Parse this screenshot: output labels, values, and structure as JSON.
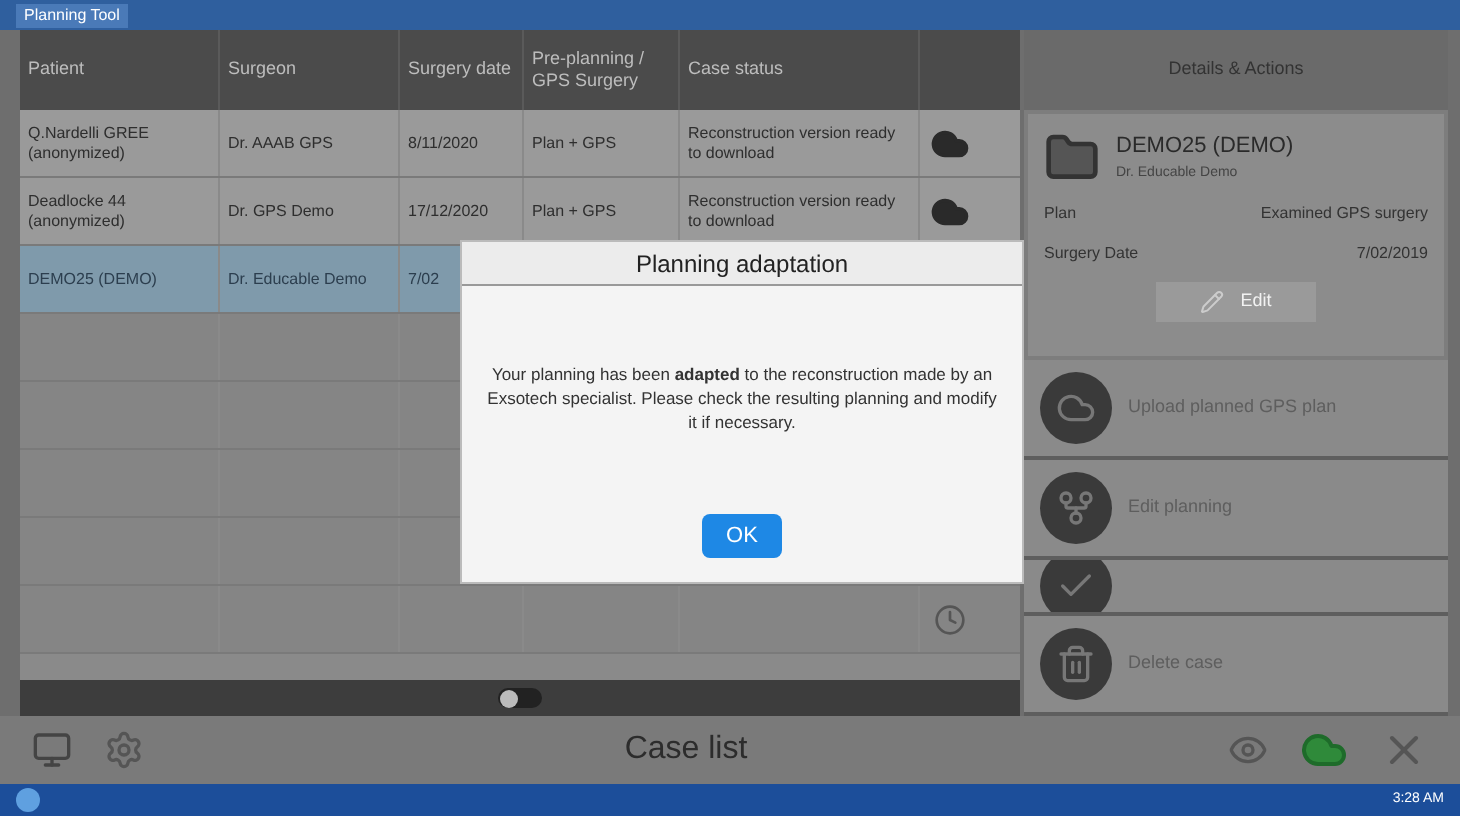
{
  "window": {
    "title": "Planning Tool"
  },
  "table": {
    "columns": [
      "Patient",
      "Surgeon",
      "Surgery date",
      "Pre-planning / GPS Surgery",
      "Case status"
    ],
    "rows": [
      {
        "cells": [
          "Q.Nardelli GREE (anonymized)",
          "Dr. AAAB GPS",
          "8/11/2020",
          "Plan + GPS",
          "Reconstruction version ready to download"
        ],
        "kind": "download",
        "selected": false
      },
      {
        "cells": [
          "Deadlocke 44 (anonymized)",
          "Dr. GPS Demo",
          "17/12/2020",
          "Plan + GPS",
          "Reconstruction version ready to download"
        ],
        "kind": "download",
        "selected": false
      },
      {
        "cells": [
          "DEMO25 (DEMO)",
          "Dr. Educable Demo",
          "7/02"
        ],
        "kind": "plain",
        "selected": true
      },
      {
        "cells": [],
        "kind": "plain",
        "selected": false
      },
      {
        "cells": [],
        "kind": "plain",
        "selected": false
      },
      {
        "cells": [],
        "kind": "plain",
        "selected": false
      },
      {
        "cells": [],
        "kind": "plain",
        "selected": false
      },
      {
        "cells": [],
        "kind": "clock",
        "selected": false
      }
    ]
  },
  "toggle": {
    "on": false
  },
  "details": {
    "title": "Details & Actions",
    "case_name": "DEMO25 (DEMO)",
    "surgeon": "Dr. Educable Demo",
    "fields": [
      {
        "label": "Plan",
        "value": "Examined GPS surgery"
      },
      {
        "label": "Surgery Date",
        "value": "7/02/2019"
      }
    ],
    "edit_button": "Edit",
    "actions": [
      {
        "kind": "cloud",
        "label": "Upload planned GPS plan"
      },
      {
        "kind": "plan",
        "label": "Edit planning"
      },
      {
        "kind": "check"
      },
      {
        "kind": "trash",
        "label": "Delete case"
      }
    ]
  },
  "toolbar": {
    "title": "Case list"
  },
  "taskbar": {
    "time": "3:28 AM"
  },
  "dialog": {
    "title": "Planning adaptation",
    "message": "Your planning has been **adapted** to the reconstruction made by an Exsotech specialist. Please check the resulting planning and modify it if necessary.",
    "button": "OK"
  }
}
